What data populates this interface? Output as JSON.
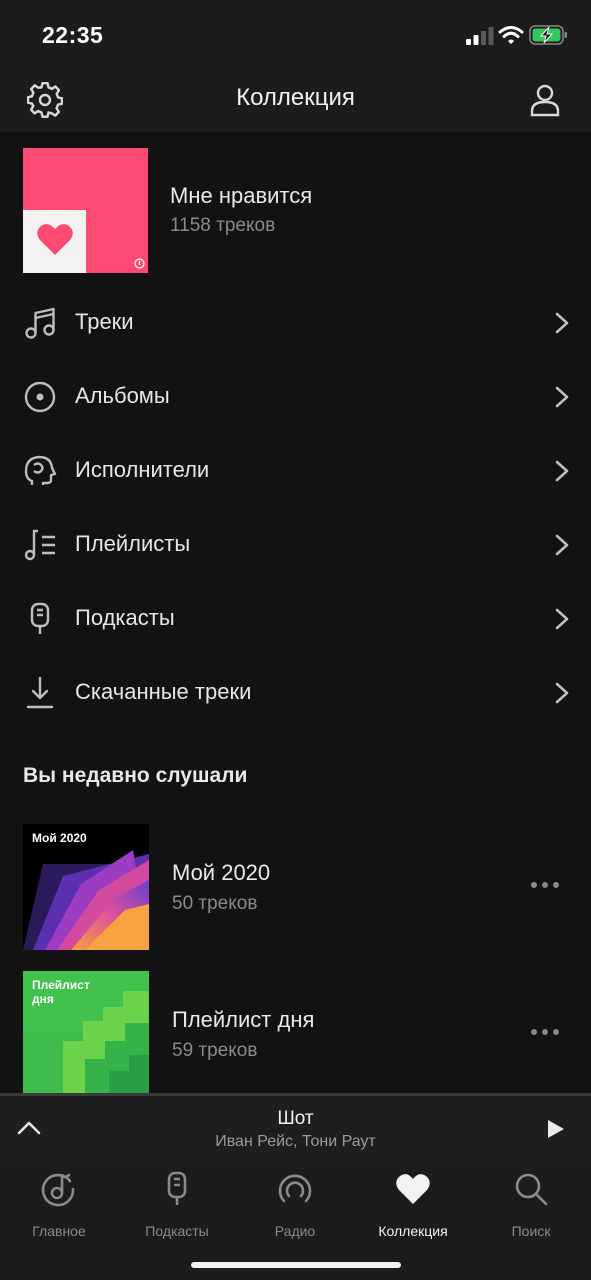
{
  "status_bar": {
    "time": "22:35",
    "icons": [
      "cellular-signal-icon",
      "wifi-icon",
      "battery-charging-icon"
    ],
    "battery_color": "#34c759"
  },
  "header": {
    "title": "Коллекция",
    "left_icon": "gear-icon",
    "right_icon": "user-icon"
  },
  "liked": {
    "title": "Мне нравится",
    "subtitle": "1158 треков",
    "cover_color": "#fc4a73"
  },
  "menu": [
    {
      "label": "Треки",
      "icon": "music-note-icon"
    },
    {
      "label": "Альбомы",
      "icon": "disc-icon"
    },
    {
      "label": "Исполнители",
      "icon": "artist-icon"
    },
    {
      "label": "Плейлисты",
      "icon": "playlist-icon"
    },
    {
      "label": "Подкасты",
      "icon": "microphone-icon"
    },
    {
      "label": "Скачанные треки",
      "icon": "download-icon"
    }
  ],
  "recent": {
    "title": "Вы недавно слушали",
    "items": [
      {
        "cover_text": "Мой 2020",
        "title": "Мой 2020",
        "subtitle": "50 треков"
      },
      {
        "cover_text": "Плейлист дня",
        "title": "Плейлист дня",
        "subtitle": "59 треков"
      }
    ]
  },
  "player": {
    "title": "Шот",
    "artist": "Иван Рейс, Тони Раут"
  },
  "tabs": [
    {
      "label": "Главное",
      "icon": "home-note-icon",
      "active": false
    },
    {
      "label": "Подкасты",
      "icon": "microphone-icon",
      "active": false
    },
    {
      "label": "Радио",
      "icon": "radio-icon",
      "active": false
    },
    {
      "label": "Коллекция",
      "icon": "heart-icon",
      "active": true
    },
    {
      "label": "Поиск",
      "icon": "search-icon",
      "active": false
    }
  ]
}
